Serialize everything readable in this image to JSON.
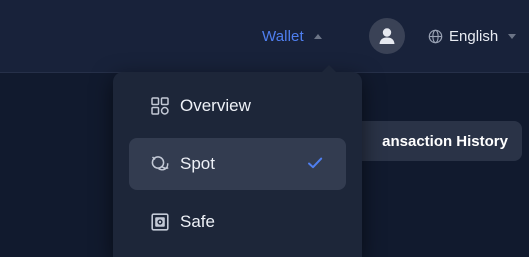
{
  "header": {
    "wallet_label": "Wallet",
    "language_label": "English"
  },
  "content": {
    "transaction_history_label": "ansaction History"
  },
  "wallet_menu": {
    "items": [
      {
        "label": "Overview",
        "icon": "grid-icon",
        "selected": false
      },
      {
        "label": "Spot",
        "icon": "coins-icon",
        "selected": true
      },
      {
        "label": "Safe",
        "icon": "safe-icon",
        "selected": false
      }
    ]
  },
  "colors": {
    "accent": "#4f7ff0",
    "header_bg": "#18223a",
    "menu_bg": "#1d2639",
    "selected_bg": "#333c50",
    "text": "#eef1f7"
  }
}
